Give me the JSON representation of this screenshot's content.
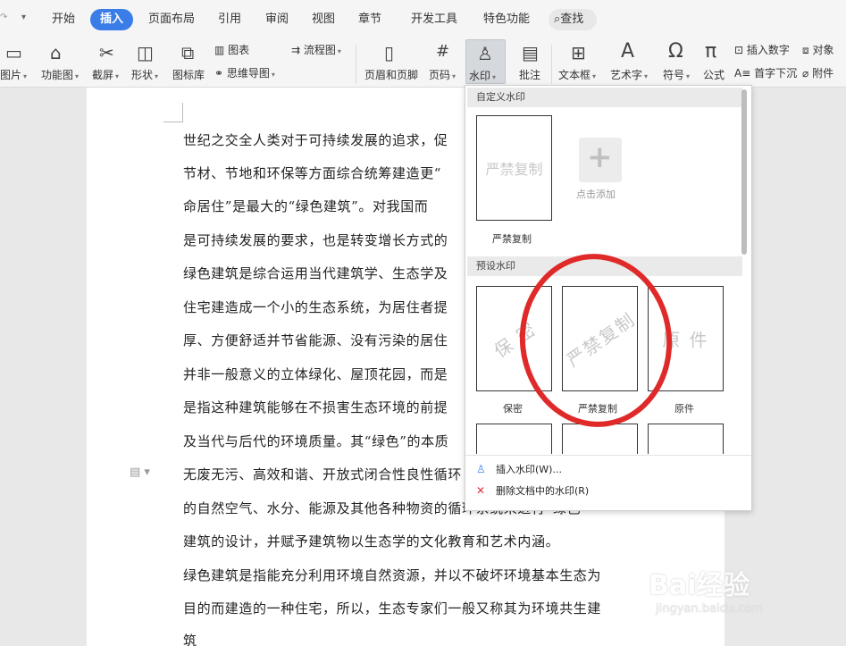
{
  "tabs": [
    "开始",
    "插入",
    "页面布局",
    "引用",
    "审阅",
    "视图",
    "章节",
    "开发工具",
    "特色功能"
  ],
  "active_tab": "插入",
  "search_label": "查找",
  "ribbon": {
    "picture": "图片",
    "function_chart": "功能图",
    "screenshot": "截屏",
    "shape": "形状",
    "icon_library": "图标库",
    "chart": "图表",
    "mindmap": "思维导图",
    "flowchart": "流程图",
    "header_footer": "页眉和页脚",
    "page_number": "页码",
    "watermark": "水印",
    "comment": "批注",
    "textbox": "文本框",
    "art_text": "艺术字",
    "symbol": "符号",
    "formula": "公式",
    "insert_number": "插入数字",
    "dropcap": "首字下沉",
    "object": "对象",
    "attachment": "附件"
  },
  "document": {
    "lines": [
      "世纪之交全人类对于可持续发展的追求，促",
      "节材、节地和环保等方面综合统筹建造更“",
      "命居住”是最大的“绿色建筑”。对我国而",
      "是可持续发展的要求，也是转变增长方式的",
      "绿色建筑是综合运用当代建筑学、生态学及",
      "住宅建造成一个小的生态系统，为居住者提",
      "厚、方便舒适并节省能源、没有污染的居住",
      "并非一般意义的立体绿化、屋顶花园，而是",
      "是指这种建筑能够在不损害生态环境的前提",
      "及当代与后代的环境质量。其“绿色”的本质",
      "无废无污、高效和谐、开放式闭合性良性循环",
      "的自然空气、水分、能源及其他各种物资的循环系统来进行“绿色",
      "建筑的设计，并赋予建筑物以生态学的文化教育和艺术内涵。",
      "绿色建筑是指能充分利用环境自然资源，并以不破坏环境基本生态为",
      "目的而建造的一种住宅，所以，生态专家们一般又称其为环境共生建",
      "筑"
    ]
  },
  "watermark_menu": {
    "custom_header": "自定义水印",
    "custom_item": {
      "text": "严禁复制",
      "caption": "严禁复制"
    },
    "add_label": "点击添加",
    "preset_header": "预设水印",
    "presets": [
      {
        "text": "保 密",
        "caption": "保密"
      },
      {
        "text": "严禁复制",
        "caption": "严禁复制"
      },
      {
        "text": "原 件",
        "caption": "原件"
      }
    ],
    "insert_label": "插入水印(W)...",
    "delete_label": "删除文档中的水印(R)"
  },
  "watermark_brand": {
    "logo": "Bai经验",
    "url": "jingyan.baidu.com"
  },
  "colors": {
    "accent": "#3a7de8",
    "annotation_circle": "#e02a2a"
  }
}
